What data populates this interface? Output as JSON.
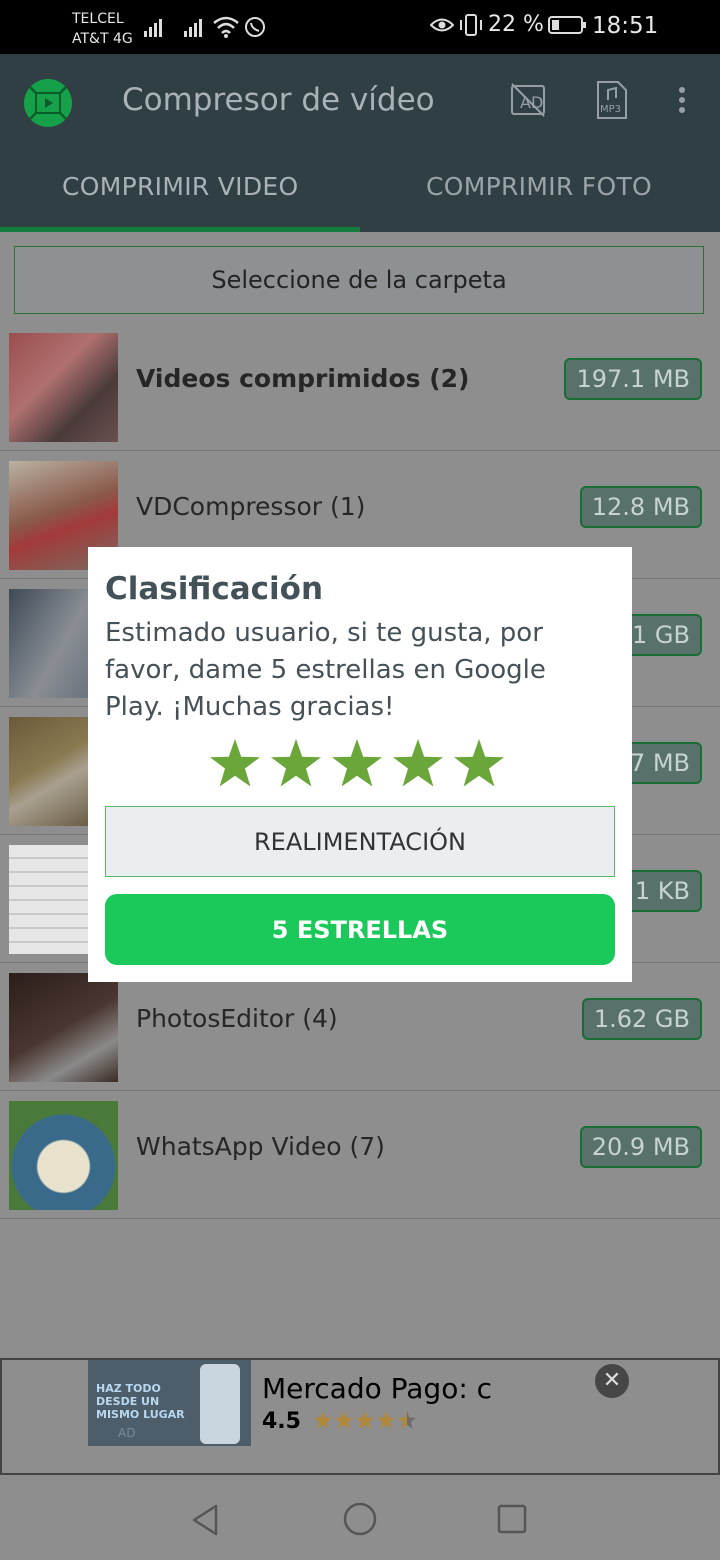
{
  "status_bar": {
    "carrier_line1": "TELCEL",
    "carrier_line2": "AT&T 4G",
    "battery": "22 %",
    "time": "18:51"
  },
  "app_bar": {
    "title": "Compresor de vídeo",
    "icons": [
      "video-compressor-logo",
      "remove-ads-icon",
      "mp3-file-icon",
      "more-options-icon"
    ]
  },
  "tabs": [
    {
      "label": "COMPRIMIR VIDEO",
      "selected": true
    },
    {
      "label": "COMPRIMIR FOTO",
      "selected": false
    }
  ],
  "folder_button": "Seleccione de la carpeta",
  "folders": [
    {
      "name": "Videos comprimidos (2)",
      "size": "197.1 MB",
      "bold": true
    },
    {
      "name": "VDCompressor (1)",
      "size": "12.8 MB"
    },
    {
      "name": "",
      "size": "1 GB"
    },
    {
      "name": "",
      "size": "7 MB"
    },
    {
      "name": "",
      "size": "1 KB"
    },
    {
      "name": "PhotosEditor (4)",
      "size": "1.62 GB"
    },
    {
      "name": "WhatsApp Video (7)",
      "size": "20.9 MB"
    }
  ],
  "dialog": {
    "title": "Clasificación",
    "message": "Estimado usuario, si te gusta, por favor, dame 5 estrellas en Google Play. ¡Muchas gracias!",
    "stars": 5,
    "feedback_button": "REALIMENTACIÓN",
    "rate_button": "5 ESTRELLAS"
  },
  "ad": {
    "title": "Mercado Pago: c",
    "rating": "4.5",
    "rating_value": 4.5,
    "image_text": "HAZ TODO DESDE UN MISMO LUGAR",
    "badge": "AD"
  },
  "colors": {
    "app_bar": "#303f44",
    "accent_green": "#1ac95a",
    "star_green": "#6aa639"
  }
}
